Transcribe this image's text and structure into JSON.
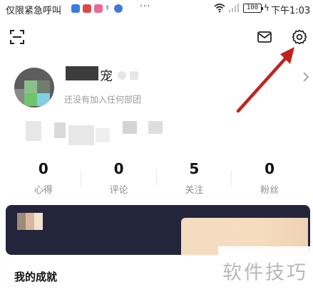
{
  "status_bar": {
    "carrier": "仅限紧急呼叫",
    "more": "···",
    "battery": "100",
    "time": "下午1:03"
  },
  "toolbar": {
    "scan_icon": "scan-icon",
    "mail_icon": "mail-icon",
    "settings_icon": "gear-icon"
  },
  "profile": {
    "name_visible": "宠",
    "subtitle": "还没有加入任何部团"
  },
  "stats": [
    {
      "value": "0",
      "label": "心得"
    },
    {
      "value": "0",
      "label": "评论"
    },
    {
      "value": "5",
      "label": "关注"
    },
    {
      "value": "0",
      "label": "粉丝"
    }
  ],
  "achievements": {
    "title": "我的成就"
  },
  "watermark": "软件技巧",
  "colors": {
    "banner_bg": "#23253d",
    "banner_card": "#f4dcc1",
    "annotation_arrow": "#c0231f"
  }
}
